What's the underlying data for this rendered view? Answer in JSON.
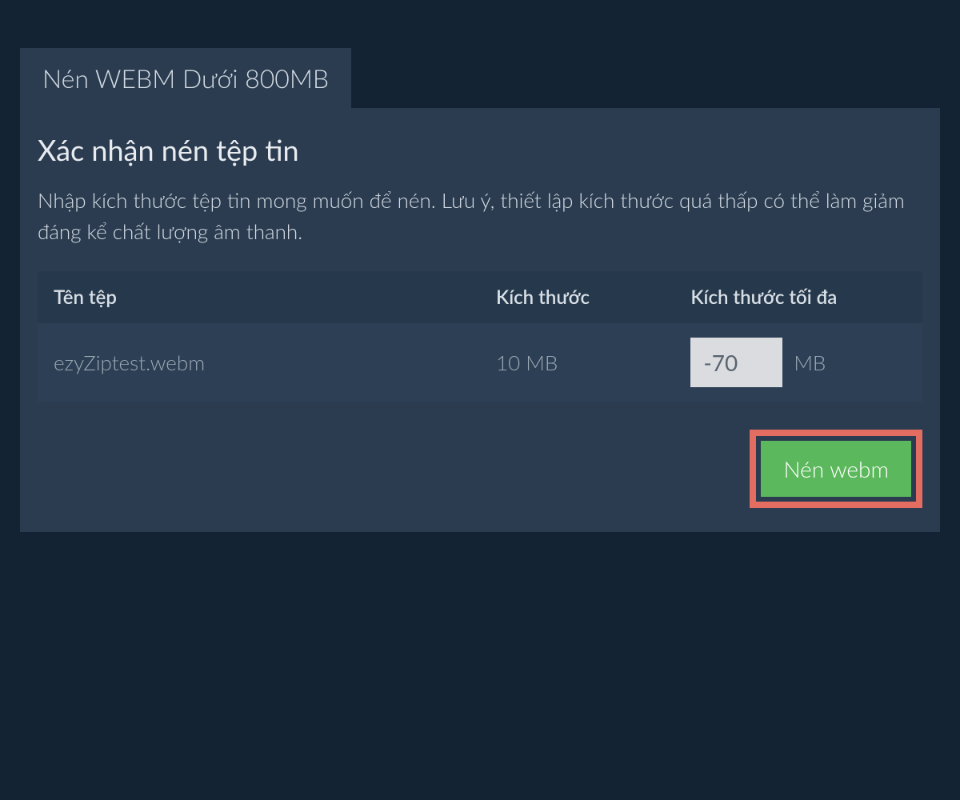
{
  "tab": {
    "label": "Nén WEBM Dưới 800MB"
  },
  "panel": {
    "title": "Xác nhận nén tệp tin",
    "description": "Nhập kích thước tệp tin mong muốn để nén. Lưu ý, thiết lập kích thước quá thấp có thể làm giảm đáng kể chất lượng âm thanh."
  },
  "table": {
    "headers": {
      "filename": "Tên tệp",
      "size": "Kích thước",
      "maxSize": "Kích thước tối đa"
    },
    "rows": [
      {
        "filename": "ezyZiptest.webm",
        "size": "10 MB",
        "maxSizeValue": "-70",
        "maxSizeUnit": "MB"
      }
    ]
  },
  "buttons": {
    "compress": "Nén webm"
  },
  "colors": {
    "background": "#132333",
    "panel": "#2b3c50",
    "tableHeader": "#26384b",
    "tableRow": "#2d3f54",
    "highlight": "#e46d62",
    "buttonGreen": "#5cb85c"
  }
}
